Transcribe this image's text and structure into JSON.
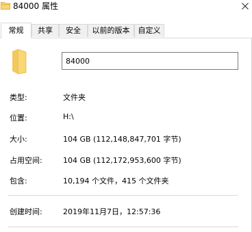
{
  "window": {
    "title": "84000 属性"
  },
  "tabs": [
    {
      "label": "常规",
      "active": true
    },
    {
      "label": "共享",
      "active": false
    },
    {
      "label": "安全",
      "active": false
    },
    {
      "label": "以前的版本",
      "active": false
    },
    {
      "label": "自定义",
      "active": false
    }
  ],
  "general": {
    "folder_name": "84000",
    "type_label": "类型:",
    "type_value": "文件夹",
    "location_label": "位置:",
    "location_value": "H:\\",
    "size_label": "大小:",
    "size_value": "104 GB (112,148,847,701 字节)",
    "size_on_disk_label": "占用空间:",
    "size_on_disk_value": "104 GB (112,172,953,600 字节)",
    "contains_label": "包含:",
    "contains_value": "10,194 个文件，415 个文件夹",
    "created_label": "创建时间:",
    "created_value": "2019年11月7日，12:57:36"
  },
  "icons": {
    "title": "folder-icon",
    "large": "folder-icon",
    "close": "close-icon"
  },
  "colors": {
    "folder_body": "#f8d775",
    "folder_tab": "#e8b84a",
    "tab_border": "#d9d9d9",
    "tab_inactive_bg": "#f0f0f0",
    "input_border": "#7a7a7a"
  }
}
